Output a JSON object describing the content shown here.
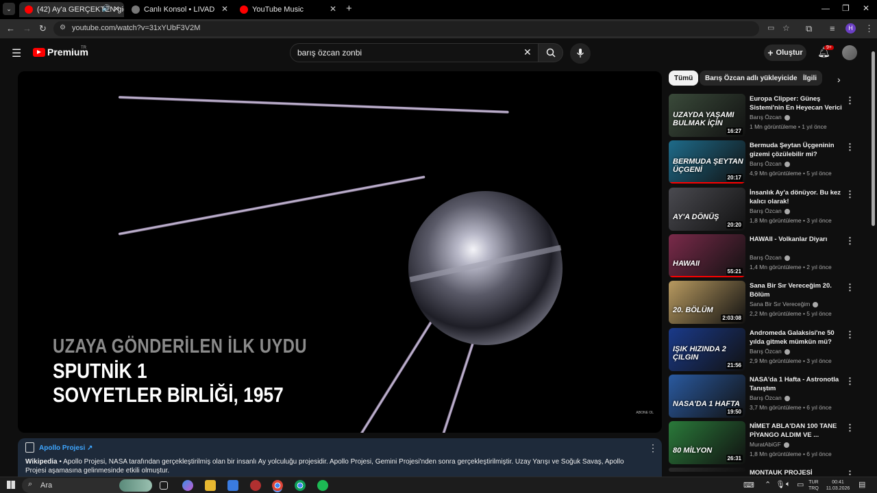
{
  "browser": {
    "tabs": [
      {
        "label": "(42) Ay'a GERÇEKTEN gidildi",
        "active": true,
        "favicon_color": "#ff0000"
      },
      {
        "label": "Canlı Konsol • LIVAD",
        "active": false,
        "favicon_color": "#cccccc"
      },
      {
        "label": "YouTube Music",
        "active": false,
        "favicon_color": "#ff0000"
      }
    ],
    "url": "youtube.com/watch?v=31xYUbF3V2M",
    "profile_initial": "H"
  },
  "header": {
    "logo_text": "Premium",
    "logo_badge": "TR",
    "search_value": "barış özcan zonbi",
    "create_label": "Oluştur",
    "notif_count": "9+"
  },
  "video": {
    "overlay_line1": "UZAYA GÖNDERİLEN İLK UYDU",
    "overlay_line2": "SPUTNİK 1",
    "overlay_line3": "SOVYETLER BİRLİĞİ, 1957",
    "watermark": "ABONE OL"
  },
  "infocard": {
    "title": "Apollo Projesi",
    "source": "Wikipedia",
    "description": " • Apollo Projesi, NASA tarafından gerçekleştirilmiş olan bir insanlı Ay yolculuğu projesidir. Apollo Projesi, Gemini Projesi'nden sonra gerçekleştirilmiştir. Uzay Yarışı ve Soğuk Savaş, Apollo Projesi aşamasına gelinmesinde etkili olmuştur."
  },
  "chips": [
    "Tümü",
    "Barış Özcan adlı yükleyiciden",
    "İlgili"
  ],
  "recommendations": [
    {
      "title": "Europa Clipper: Güneş Sistemi'nin En Heyecan Verici ...",
      "channel": "Barış Özcan",
      "meta": "1 Mn görüntüleme • 1 yıl önce",
      "duration": "16:27",
      "thumb_text": "UZAYDA YAŞAMI BULMAK İÇİN",
      "thumb_color": "#3a4a3a",
      "watched": 0.0
    },
    {
      "title": "Bermuda Şeytan Üçgeninin gizemi çözülebilir mi?",
      "channel": "Barış Özcan",
      "meta": "4,9 Mn görüntüleme • 5 yıl önce",
      "duration": "20:17",
      "thumb_text": "BERMUDA ŞEYTAN ÜÇGENİ",
      "thumb_color": "#1e6b8a",
      "watched": 1.0
    },
    {
      "title": "İnsanlık Ay'a dönüyor. Bu kez kalıcı olarak!",
      "channel": "Barış Özcan",
      "meta": "1,8 Mn görüntüleme • 3 yıl önce",
      "duration": "20:20",
      "thumb_text": "AY'A DÖNÜŞ",
      "thumb_color": "#4a4a50",
      "watched": 0.0
    },
    {
      "title": "HAWAII - Volkanlar Diyarı",
      "channel": "Barış Özcan",
      "meta": "1,4 Mn görüntüleme • 2 yıl önce",
      "duration": "55:21",
      "thumb_text": "HAWAII",
      "thumb_color": "#7a2a4a",
      "watched": 1.0
    },
    {
      "title": "Sana Bir Sır Vereceğim 20. Bölüm",
      "channel": "Sana Bir Sır Vereceğim",
      "meta": "2,2 Mn görüntüleme • 5 yıl önce",
      "duration": "2:03:08",
      "thumb_text": "20. BÖLÜM",
      "thumb_color": "#b89a60",
      "watched": 0.0
    },
    {
      "title": "Andromeda Galaksisi'ne 50 yılda gitmek mümkün mü?",
      "channel": "Barış Özcan",
      "meta": "2,9 Mn görüntüleme • 3 yıl önce",
      "duration": "21:56",
      "thumb_text": "IŞIK HIZINDA 2 ÇILGIN",
      "thumb_color": "#1a3a8a",
      "watched": 0.0
    },
    {
      "title": "NASA'da 1 Hafta - Astronotla Tanıştım",
      "channel": "Barış Özcan",
      "meta": "3,7 Mn görüntüleme • 6 yıl önce",
      "duration": "19:50",
      "thumb_text": "NASA'DA 1 HAFTA",
      "thumb_color": "#2a5aa0",
      "watched": 0.0
    },
    {
      "title": "NİMET ABLA'DAN 100 TANE PİYANGO ALDIM VE ...",
      "channel": "MuratAbiGF",
      "meta": "1,8 Mn görüntüleme • 6 yıl önce",
      "duration": "26:31",
      "thumb_text": "80 MİLYON",
      "thumb_color": "#2a7a3a",
      "watched": 0.0
    },
    {
      "title": "MONTAUK PROJESİ",
      "channel": "",
      "meta": "",
      "duration": "",
      "thumb_text": "",
      "thumb_color": "#2a2a2a",
      "watched": 0.0
    }
  ],
  "taskbar": {
    "search_placeholder": "Ara",
    "lang_top": "TUR",
    "lang_bottom": "TRQ",
    "time": "00:41",
    "date": "11.03.2026"
  }
}
